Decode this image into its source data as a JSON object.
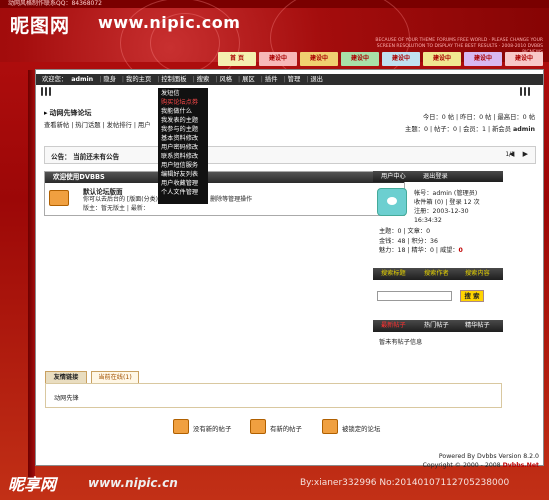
{
  "banner": {
    "contact": "动网风格制作联系QQ：84368072",
    "logo_cn": "昵图网",
    "logo_url": "www.nipic.com",
    "tagline": "BECAUSE OF YOUR THEME FORUMS FREE WORLD · PLEASE CHANGE YOUR SCREEN RESOLUTION TO DISPLAY THE BEST RESULTS · 2008-2010 DVBBS PICNEWS",
    "flags": [
      {
        "label": "首 页",
        "color": "#f4f0b0"
      },
      {
        "label": "建设中",
        "color": "#f7b8b8"
      },
      {
        "label": "建设中",
        "color": "#f0d070"
      },
      {
        "label": "建设中",
        "color": "#a8e0a8"
      },
      {
        "label": "建设中",
        "color": "#c0e0f0"
      },
      {
        "label": "建设中",
        "color": "#f0e890"
      },
      {
        "label": "建设中",
        "color": "#d8b8f0"
      },
      {
        "label": "建设中",
        "color": "#f8c8c8"
      }
    ]
  },
  "nav": {
    "welcome": "欢迎您：",
    "user": "admin",
    "items": [
      "隐身",
      "我的主页",
      "控制面板",
      "搜索",
      "风格",
      "展区",
      "插件",
      "管理",
      "退出"
    ]
  },
  "forum": {
    "title": "动网先锋论坛",
    "links": "查看新帖 | 热门话题 | 发帖排行 | 用户",
    "stats1": "今日：0 帖 | 昨日：0 帖 | 最高日：0 帖",
    "stats2_prefix": "主题：0 | 帖子：0 | 会员：1 | 新会员",
    "stats2_user": "admin"
  },
  "dropdown": {
    "items": [
      {
        "label": "发短信",
        "highlight": false
      },
      {
        "label": "购买论坛点券",
        "highlight": true
      },
      {
        "label": "我能做什么",
        "highlight": false
      },
      {
        "label": "我发表的主题",
        "highlight": false
      },
      {
        "label": "我参与的主题",
        "highlight": false
      },
      {
        "label": "基本资料修改",
        "highlight": false
      },
      {
        "label": "用户密码修改",
        "highlight": false
      },
      {
        "label": "联系资料修改",
        "highlight": false
      },
      {
        "label": "用户短信服务",
        "highlight": false
      },
      {
        "label": "编辑好友列表",
        "highlight": false
      },
      {
        "label": "用户收藏管理",
        "highlight": false
      },
      {
        "label": "个人文件管理",
        "highlight": false
      }
    ]
  },
  "announce": {
    "text": "公告： 当前还未有公告",
    "page": "1/1",
    "controls": "◀ ▶"
  },
  "welcome": {
    "title": "欢迎使用DVBBS",
    "board_name": "默认论坛版面",
    "board_desc": "你可以去后台的 [版面(分类)管理] 中修改分类、删除等管理操作",
    "board_meta": "版主：暂无版主 | 最新："
  },
  "user_panel": {
    "tabs": [
      "用户中心",
      "退出登录"
    ],
    "info": [
      "帐号：admin (管理员)",
      "收件箱 (0) | 登录 12 次",
      "注册：2003-12-30",
      "16:34:32"
    ],
    "stats_line1": "主题：0 | 文章：0",
    "stats_line2": "金钱：48 | 积分：36",
    "stats_line3_prefix": "魅力：18 | 精华：0 | 威望：",
    "stats_line3_value": "0"
  },
  "search": {
    "tabs": [
      "搜索标题",
      "搜索作者",
      "搜索内容"
    ],
    "button": "搜 索",
    "placeholder": ""
  },
  "posts": {
    "tabs": [
      "最新帖子",
      "热门帖子",
      "精华帖子"
    ],
    "empty": "暂未有帖子信息"
  },
  "friends": {
    "tabs": [
      "友情链接",
      "当前在线(1)"
    ],
    "content": "动网先锋"
  },
  "legend": [
    {
      "label": "没有新的帖子"
    },
    {
      "label": "有新的帖子"
    },
    {
      "label": "被锁定的论坛"
    }
  ],
  "footer": {
    "powered": "Powered By Dvbbs Version 8.2.0",
    "copyright_prefix": "Copyright © 2000 - 2008 ",
    "copyright_brand": "Dvbbs.Net"
  },
  "watermark": {
    "logo": "昵享网",
    "url": "www.nipic.cn",
    "id": "By:xianer332996 No:20140107112705238000"
  }
}
